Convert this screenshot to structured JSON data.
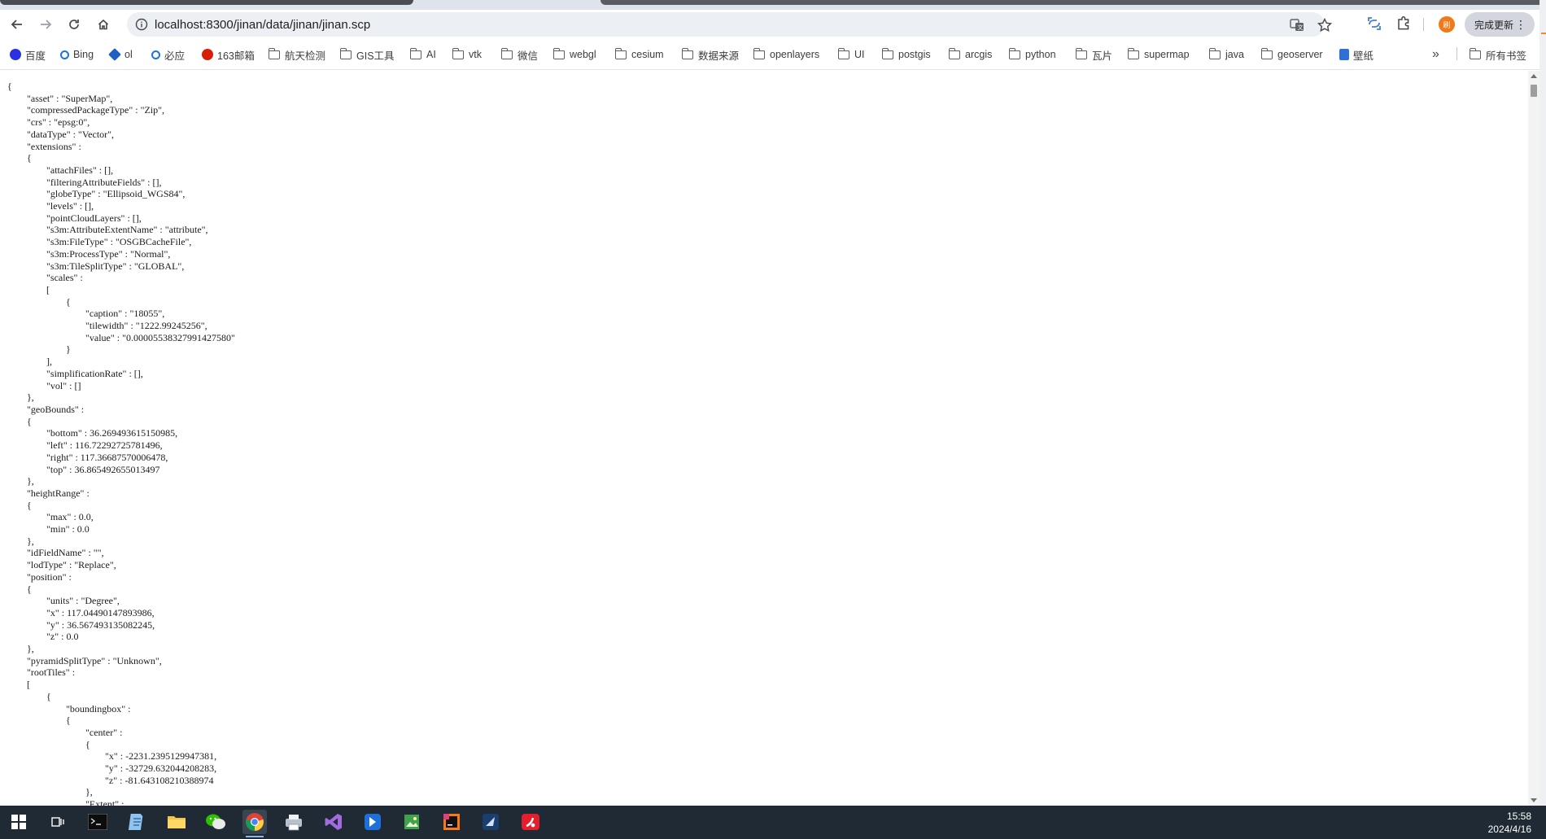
{
  "browser": {
    "url": "localhost:8300/jinan/data/jinan/jinan.scp",
    "update_button_label": "完成更新",
    "profile_initial": "刷"
  },
  "bookmarks": [
    {
      "label": "百度",
      "icon": "baidu-icon"
    },
    {
      "label": "Bing",
      "icon": "search-icon"
    },
    {
      "label": "ol",
      "icon": "layers-icon"
    },
    {
      "label": "必应",
      "icon": "search-icon"
    },
    {
      "label": "163邮箱",
      "icon": "mail-icon"
    },
    {
      "label": "航天检测",
      "icon": "folder-icon"
    },
    {
      "label": "GIS工具",
      "icon": "folder-icon"
    },
    {
      "label": "AI",
      "icon": "folder-icon"
    },
    {
      "label": "vtk",
      "icon": "folder-icon"
    },
    {
      "label": "微信",
      "icon": "folder-icon"
    },
    {
      "label": "webgl",
      "icon": "folder-icon"
    },
    {
      "label": "cesium",
      "icon": "folder-icon"
    },
    {
      "label": "数据来源",
      "icon": "folder-icon"
    },
    {
      "label": "openlayers",
      "icon": "folder-icon"
    },
    {
      "label": "UI",
      "icon": "folder-icon"
    },
    {
      "label": "postgis",
      "icon": "folder-icon"
    },
    {
      "label": "arcgis",
      "icon": "folder-icon"
    },
    {
      "label": "python",
      "icon": "folder-icon"
    },
    {
      "label": "瓦片",
      "icon": "folder-icon"
    },
    {
      "label": "supermap",
      "icon": "folder-icon"
    },
    {
      "label": "java",
      "icon": "folder-icon"
    },
    {
      "label": "geoserver",
      "icon": "folder-icon"
    },
    {
      "label": "壁纸",
      "icon": "uu-icon"
    }
  ],
  "bookmarks_more_label": "»",
  "all_bookmarks_label": "所有书签",
  "json_text": "{\n\t\"asset\" : \"SuperMap\",\n\t\"compressedPackageType\" : \"Zip\",\n\t\"crs\" : \"epsg:0\",\n\t\"dataType\" : \"Vector\",\n\t\"extensions\" : \n\t{\n\t\t\"attachFiles\" : [],\n\t\t\"filteringAttributeFields\" : [],\n\t\t\"globeType\" : \"Ellipsoid_WGS84\",\n\t\t\"levels\" : [],\n\t\t\"pointCloudLayers\" : [],\n\t\t\"s3m:AttributeExtentName\" : \"attribute\",\n\t\t\"s3m:FileType\" : \"OSGBCacheFile\",\n\t\t\"s3m:ProcessType\" : \"Normal\",\n\t\t\"s3m:TileSplitType\" : \"GLOBAL\",\n\t\t\"scales\" : \n\t\t[\n\t\t\t{\n\t\t\t\t\"caption\" : \"18055\",\n\t\t\t\t\"tilewidth\" : \"1222.99245256\",\n\t\t\t\t\"value\" : \"0.00005538327991427580\"\n\t\t\t}\n\t\t],\n\t\t\"simplificationRate\" : [],\n\t\t\"vol\" : []\n\t},\n\t\"geoBounds\" : \n\t{\n\t\t\"bottom\" : 36.269493615150985,\n\t\t\"left\" : 116.72292725781496,\n\t\t\"right\" : 117.36687570006478,\n\t\t\"top\" : 36.865492655013497\n\t},\n\t\"heightRange\" : \n\t{\n\t\t\"max\" : 0.0,\n\t\t\"min\" : 0.0\n\t},\n\t\"idFieldName\" : \"\",\n\t\"lodType\" : \"Replace\",\n\t\"position\" : \n\t{\n\t\t\"units\" : \"Degree\",\n\t\t\"x\" : 117.04490147893986,\n\t\t\"y\" : 36.567493135082245,\n\t\t\"z\" : 0.0\n\t},\n\t\"pyramidSplitType\" : \"Unknown\",\n\t\"rootTiles\" : \n\t[\n\t\t{\n\t\t\t\"boundingbox\" : \n\t\t\t{\n\t\t\t\t\"center\" : \n\t\t\t\t{\n\t\t\t\t\t\"x\" : -2231.2395129947381,\n\t\t\t\t\t\"y\" : -32729.632044208283,\n\t\t\t\t\t\"z\" : -81.643108210388974\n\t\t\t\t},\n\t\t\t\t\"Extent\" : ",
  "clock": {
    "time": "15:58",
    "date": "2024/4/16"
  }
}
